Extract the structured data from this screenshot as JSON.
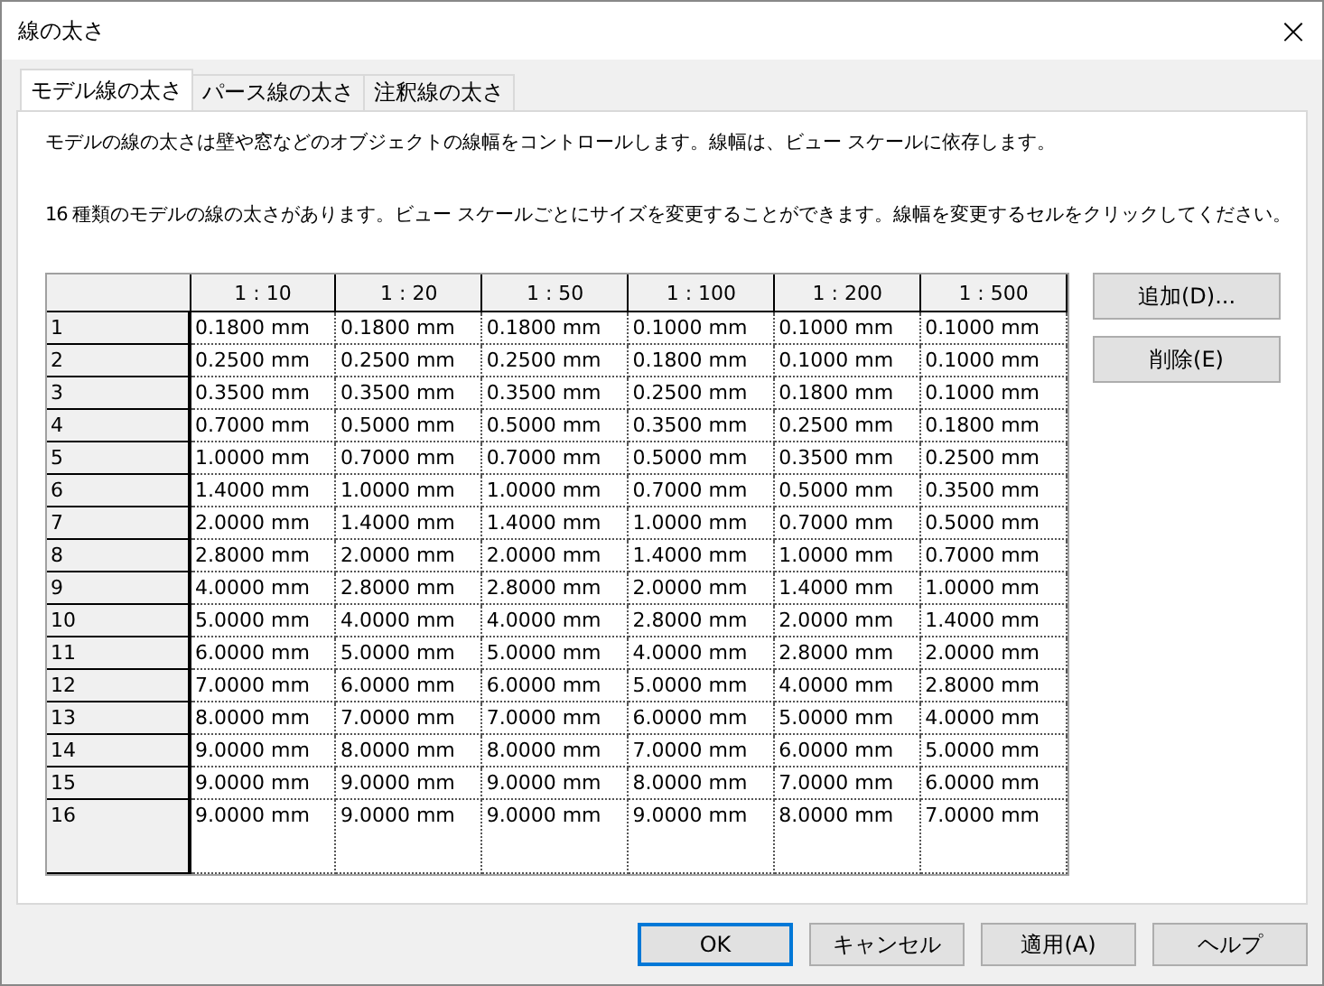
{
  "window": {
    "title": "線の太さ",
    "close": "×"
  },
  "tabs": [
    {
      "label": "モデル線の太さ",
      "selected": true
    },
    {
      "label": "パース線の太さ",
      "selected": false
    },
    {
      "label": "注釈線の太さ",
      "selected": false
    }
  ],
  "description": [
    "モデルの線の太さは壁や窓などのオブジェクトの線幅をコントロールします。線幅は、ビュー スケールに依存します。",
    "16 種類のモデルの線の太さがあります。ビュー スケールごとにサイズを変更することができます。線幅を変更するセルをクリックしてください。"
  ],
  "table": {
    "columns": [
      "1 : 10",
      "1 : 20",
      "1 : 50",
      "1 : 100",
      "1 : 200",
      "1 : 500"
    ],
    "rows": [
      {
        "label": "1",
        "cells": [
          "0.1800 mm",
          "0.1800 mm",
          "0.1800 mm",
          "0.1000 mm",
          "0.1000 mm",
          "0.1000 mm"
        ]
      },
      {
        "label": "2",
        "cells": [
          "0.2500 mm",
          "0.2500 mm",
          "0.2500 mm",
          "0.1800 mm",
          "0.1000 mm",
          "0.1000 mm"
        ]
      },
      {
        "label": "3",
        "cells": [
          "0.3500 mm",
          "0.3500 mm",
          "0.3500 mm",
          "0.2500 mm",
          "0.1800 mm",
          "0.1000 mm"
        ]
      },
      {
        "label": "4",
        "cells": [
          "0.7000 mm",
          "0.5000 mm",
          "0.5000 mm",
          "0.3500 mm",
          "0.2500 mm",
          "0.1800 mm"
        ]
      },
      {
        "label": "5",
        "cells": [
          "1.0000 mm",
          "0.7000 mm",
          "0.7000 mm",
          "0.5000 mm",
          "0.3500 mm",
          "0.2500 mm"
        ]
      },
      {
        "label": "6",
        "cells": [
          "1.4000 mm",
          "1.0000 mm",
          "1.0000 mm",
          "0.7000 mm",
          "0.5000 mm",
          "0.3500 mm"
        ]
      },
      {
        "label": "7",
        "cells": [
          "2.0000 mm",
          "1.4000 mm",
          "1.4000 mm",
          "1.0000 mm",
          "0.7000 mm",
          "0.5000 mm"
        ]
      },
      {
        "label": "8",
        "cells": [
          "2.8000 mm",
          "2.0000 mm",
          "2.0000 mm",
          "1.4000 mm",
          "1.0000 mm",
          "0.7000 mm"
        ]
      },
      {
        "label": "9",
        "cells": [
          "4.0000 mm",
          "2.8000 mm",
          "2.8000 mm",
          "2.0000 mm",
          "1.4000 mm",
          "1.0000 mm"
        ]
      },
      {
        "label": "10",
        "cells": [
          "5.0000 mm",
          "4.0000 mm",
          "4.0000 mm",
          "2.8000 mm",
          "2.0000 mm",
          "1.4000 mm"
        ]
      },
      {
        "label": "11",
        "cells": [
          "6.0000 mm",
          "5.0000 mm",
          "5.0000 mm",
          "4.0000 mm",
          "2.8000 mm",
          "2.0000 mm"
        ]
      },
      {
        "label": "12",
        "cells": [
          "7.0000 mm",
          "6.0000 mm",
          "6.0000 mm",
          "5.0000 mm",
          "4.0000 mm",
          "2.8000 mm"
        ]
      },
      {
        "label": "13",
        "cells": [
          "8.0000 mm",
          "7.0000 mm",
          "7.0000 mm",
          "6.0000 mm",
          "5.0000 mm",
          "4.0000 mm"
        ]
      },
      {
        "label": "14",
        "cells": [
          "9.0000 mm",
          "8.0000 mm",
          "8.0000 mm",
          "7.0000 mm",
          "6.0000 mm",
          "5.0000 mm"
        ]
      },
      {
        "label": "15",
        "cells": [
          "9.0000 mm",
          "9.0000 mm",
          "9.0000 mm",
          "8.0000 mm",
          "7.0000 mm",
          "6.0000 mm"
        ]
      },
      {
        "label": "16",
        "cells": [
          "9.0000 mm",
          "9.0000 mm",
          "9.0000 mm",
          "9.0000 mm",
          "8.0000 mm",
          "7.0000 mm"
        ]
      }
    ]
  },
  "side_buttons": [
    "追加(D)...",
    "削除(E)"
  ],
  "buttons": [
    {
      "label": "OK",
      "default": true
    },
    {
      "label": "キャンセル",
      "default": false
    },
    {
      "label": "適用(A)",
      "default": false
    },
    {
      "label": "ヘルプ",
      "default": false
    }
  ]
}
